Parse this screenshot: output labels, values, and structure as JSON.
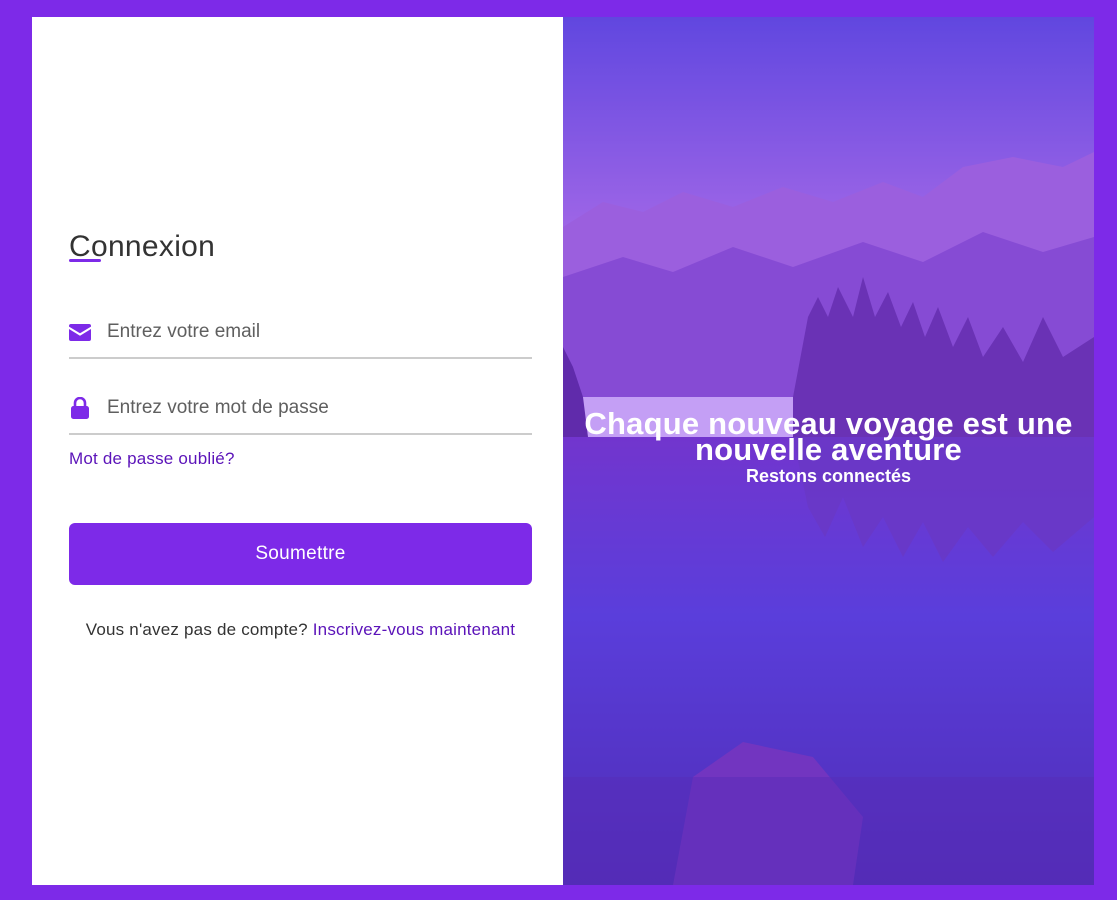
{
  "login": {
    "title": "Connexion",
    "email_placeholder": "Entrez votre email",
    "password_placeholder": "Entrez votre mot de passe",
    "forgot_label": "Mot de passe oublié?",
    "submit_label": "Soumettre",
    "signup_text": "Vous n'avez pas de compte?",
    "signup_link": "Inscrivez-vous maintenant",
    "icons": {
      "email": "envelope-icon",
      "password": "lock-icon"
    }
  },
  "hero": {
    "tagline": "Chaque nouveau voyage est une nouvelle aventure",
    "subtitle": "Restons connectés"
  },
  "colors": {
    "accent": "#7d2ae8",
    "link": "#5b13b9",
    "page_background": "#7d2ae8"
  }
}
